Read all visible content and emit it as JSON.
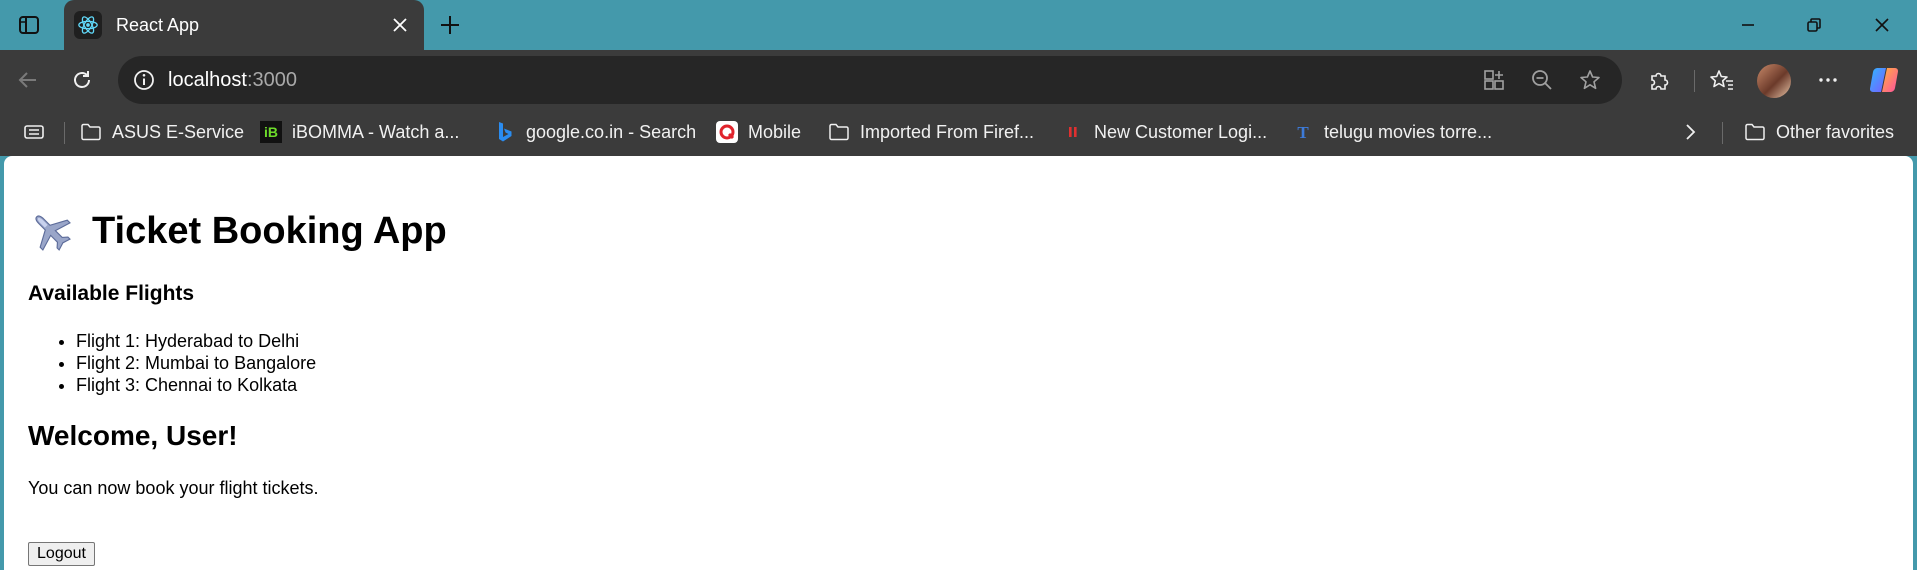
{
  "browser": {
    "tab": {
      "title": "React App"
    },
    "address_bar": {
      "host": "localhost",
      "port": ":3000"
    },
    "bookmarks": [
      {
        "label": "ASUS E-Service",
        "icon": "folder-icon"
      },
      {
        "label": "iBOMMA - Watch a...",
        "icon": "ibomma-icon"
      },
      {
        "label": "google.co.in - Search",
        "icon": "bing-icon"
      },
      {
        "label": "Mobile",
        "icon": "mobile-app-icon"
      },
      {
        "label": "Imported From Firef...",
        "icon": "folder-icon"
      },
      {
        "label": "New Customer Logi...",
        "icon": "pause-red-icon"
      },
      {
        "label": "telugu movies torre...",
        "icon": "t-icon"
      }
    ],
    "other_favorites": "Other favorites",
    "colors": {
      "tabstrip": "#4499ab",
      "toolbar": "#3b3b3b",
      "omnibox": "#262626"
    }
  },
  "app": {
    "title": "Ticket Booking App",
    "title_icon": "airplane-icon",
    "flights_heading": "Available Flights",
    "flights": [
      "Flight 1: Hyderabad to Delhi",
      "Flight 2: Mumbai to Bangalore",
      "Flight 3: Chennai to Kolkata"
    ],
    "welcome": "Welcome, User!",
    "message": "You can now book your flight tickets.",
    "logout_label": "Logout"
  }
}
